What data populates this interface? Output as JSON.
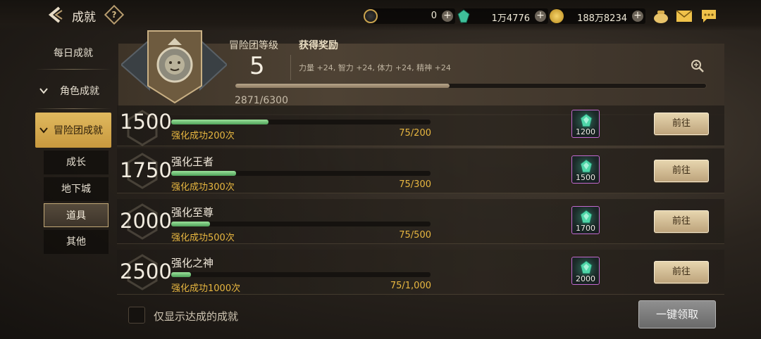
{
  "header": {
    "title": "成就",
    "help_icon": "?"
  },
  "currencies": [
    {
      "name": "coin-c",
      "value": "0"
    },
    {
      "name": "gem",
      "value": "1万4776"
    },
    {
      "name": "gold",
      "value": "188万8234"
    }
  ],
  "top_icons": [
    "bag-icon",
    "mail-icon",
    "chat-icon"
  ],
  "sidebar": {
    "items": [
      {
        "label": "每日成就"
      },
      {
        "label": "角色成就"
      },
      {
        "label": "冒险团成就"
      }
    ],
    "subitems": [
      {
        "label": "成长"
      },
      {
        "label": "地下城"
      },
      {
        "label": "道具"
      },
      {
        "label": "其他"
      }
    ],
    "selected_subitem": "道具"
  },
  "summary": {
    "level_label": "冒险团等级",
    "level": "5",
    "reward_label": "获得奖励",
    "reward_text": "力量 +24, 智力 +24, 体力 +24, 精神 +24",
    "xp_current": 2871,
    "xp_max": 6300,
    "xp_text": "2871/6300"
  },
  "achievements": [
    {
      "points": "1500",
      "name": "",
      "condition": "强化成功200次",
      "progress": "75/200",
      "fraction": 0.375,
      "reward_count": "1200",
      "button": "前往"
    },
    {
      "points": "1750",
      "name": "强化王者",
      "condition": "强化成功300次",
      "progress": "75/300",
      "fraction": 0.25,
      "reward_count": "1500",
      "button": "前往"
    },
    {
      "points": "2000",
      "name": "强化至尊",
      "condition": "强化成功500次",
      "progress": "75/500",
      "fraction": 0.15,
      "reward_count": "1700",
      "button": "前往"
    },
    {
      "points": "2500",
      "name": "强化之神",
      "condition": "强化成功1000次",
      "progress": "75/1,000",
      "fraction": 0.075,
      "reward_count": "2000",
      "button": "前往"
    }
  ],
  "footer": {
    "checkbox_label": "仅显示达成的成就",
    "claim_all": "一键领取"
  }
}
